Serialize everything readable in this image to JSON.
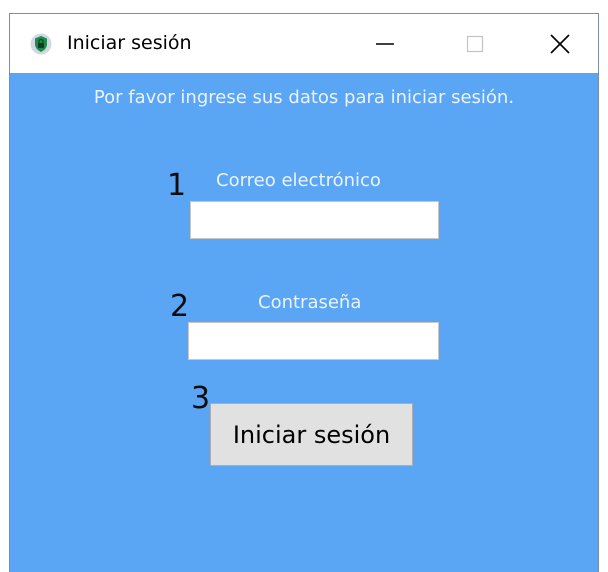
{
  "window": {
    "title": "Iniciar sesión",
    "icon": "lock-shield-icon"
  },
  "colors": {
    "background": "#5ba5f5",
    "text_light": "#eaf3ff",
    "button": "#e1e1e1"
  },
  "form": {
    "instructions": "Por favor ingrese sus datos para iniciar sesión.",
    "email": {
      "number": "1",
      "label": "Correo electrónico",
      "value": ""
    },
    "password": {
      "number": "2",
      "label": "Contraseña",
      "value": ""
    },
    "submit": {
      "number": "3",
      "label": "Iniciar sesión"
    }
  }
}
